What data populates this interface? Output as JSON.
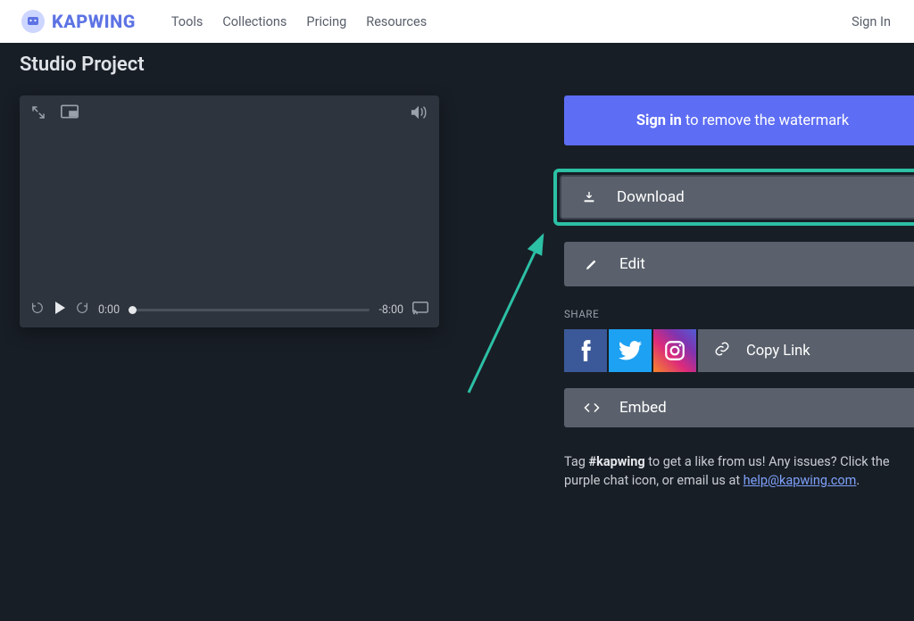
{
  "brand": {
    "name": "KAPWING"
  },
  "nav": {
    "items": [
      "Tools",
      "Collections",
      "Pricing",
      "Resources"
    ],
    "signin": "Sign In"
  },
  "page": {
    "title": "Studio Project"
  },
  "player": {
    "current_time": "0:00",
    "remaining": "-8:00"
  },
  "right": {
    "watermark": {
      "bold": "Sign in",
      "rest": " to remove the watermark"
    },
    "download": "Download",
    "edit": "Edit",
    "share_label": "SHARE",
    "copy_link": "Copy Link",
    "embed": "Embed",
    "tag_note": {
      "pre": "Tag ",
      "hashtag": "#kapwing",
      "mid": " to get a like from us! Any issues? Click the purple chat icon, or email us at ",
      "email": "help@kapwing.com",
      "post": "."
    }
  },
  "icons": {
    "expand": "expand-icon",
    "pip": "pip-icon",
    "volume": "volume-icon",
    "rewind15": "rewind-15-icon",
    "play": "play-icon",
    "forward15": "forward-15-icon",
    "cast": "cast-icon",
    "download": "download-icon",
    "edit": "pencil-icon",
    "link": "link-icon",
    "embed": "code-icon",
    "facebook": "facebook-icon",
    "twitter": "twitter-icon",
    "instagram": "instagram-icon"
  }
}
